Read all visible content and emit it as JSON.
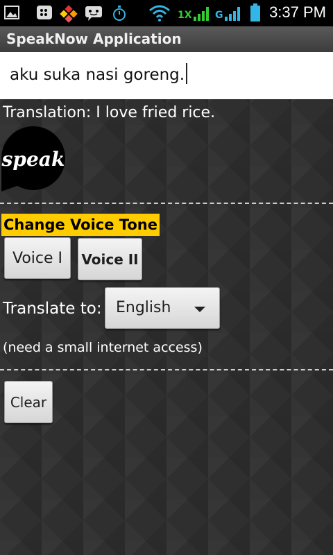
{
  "status_bar": {
    "time": "3:37 PM",
    "icons": [
      "image-icon",
      "bbm-icon",
      "app-grid-icon",
      "chat-icon",
      "stopwatch-icon",
      "wifi-icon",
      "signal-1x-icon",
      "signal-g-icon",
      "battery-icon"
    ],
    "network_labels": [
      "1X",
      "G"
    ]
  },
  "app": {
    "title": "SpeakNow Application"
  },
  "input": {
    "value": "aku suka nasi goreng."
  },
  "translation": {
    "text": "Translation:  I love fried rice."
  },
  "speak_button": {
    "label": "speak"
  },
  "voice_tone": {
    "header": "Change Voice Tone",
    "voice1": "Voice I",
    "voice2": "Voice II"
  },
  "translate_to": {
    "label": "Translate to:",
    "selected": "English",
    "note": "(need a small internet access)"
  },
  "clear_button": {
    "label": "Clear"
  },
  "colors": {
    "accent_yellow": "#ffcc00",
    "signal_green": "#33cc33",
    "status_blue": "#33b5e5",
    "background": "#2f2f2f"
  }
}
